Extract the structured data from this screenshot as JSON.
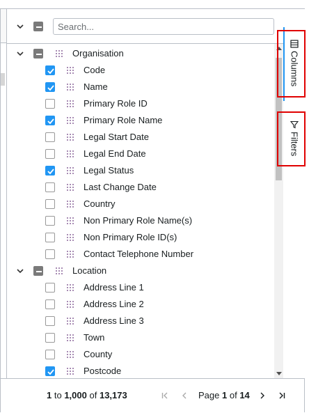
{
  "search": {
    "placeholder": "Search..."
  },
  "groups": [
    {
      "label": "Organisation",
      "items": [
        {
          "label": "Code",
          "checked": true
        },
        {
          "label": "Name",
          "checked": true
        },
        {
          "label": "Primary Role ID",
          "checked": false
        },
        {
          "label": "Primary Role Name",
          "checked": true
        },
        {
          "label": "Legal Start Date",
          "checked": false
        },
        {
          "label": "Legal End Date",
          "checked": false
        },
        {
          "label": "Legal Status",
          "checked": true
        },
        {
          "label": "Last Change Date",
          "checked": false
        },
        {
          "label": "Country",
          "checked": false
        },
        {
          "label": "Non Primary Role Name(s)",
          "checked": false
        },
        {
          "label": "Non Primary Role ID(s)",
          "checked": false
        },
        {
          "label": "Contact Telephone Number",
          "checked": false
        }
      ]
    },
    {
      "label": "Location",
      "items": [
        {
          "label": "Address Line 1",
          "checked": false
        },
        {
          "label": "Address Line 2",
          "checked": false
        },
        {
          "label": "Address Line 3",
          "checked": false
        },
        {
          "label": "Town",
          "checked": false
        },
        {
          "label": "County",
          "checked": false
        },
        {
          "label": "Postcode",
          "checked": true
        }
      ]
    }
  ],
  "side_tabs": {
    "columns": "Columns",
    "filters": "Filters"
  },
  "footer": {
    "from": "1",
    "to_word": "to",
    "to": "1,000",
    "of_word": "of",
    "total": "13,173",
    "page_word": "Page",
    "page": "1",
    "page_of_word": "of",
    "pages": "14"
  },
  "colors": {
    "accent": "#2196f3",
    "highlight_box": "#e00000",
    "border": "#babfc7"
  }
}
